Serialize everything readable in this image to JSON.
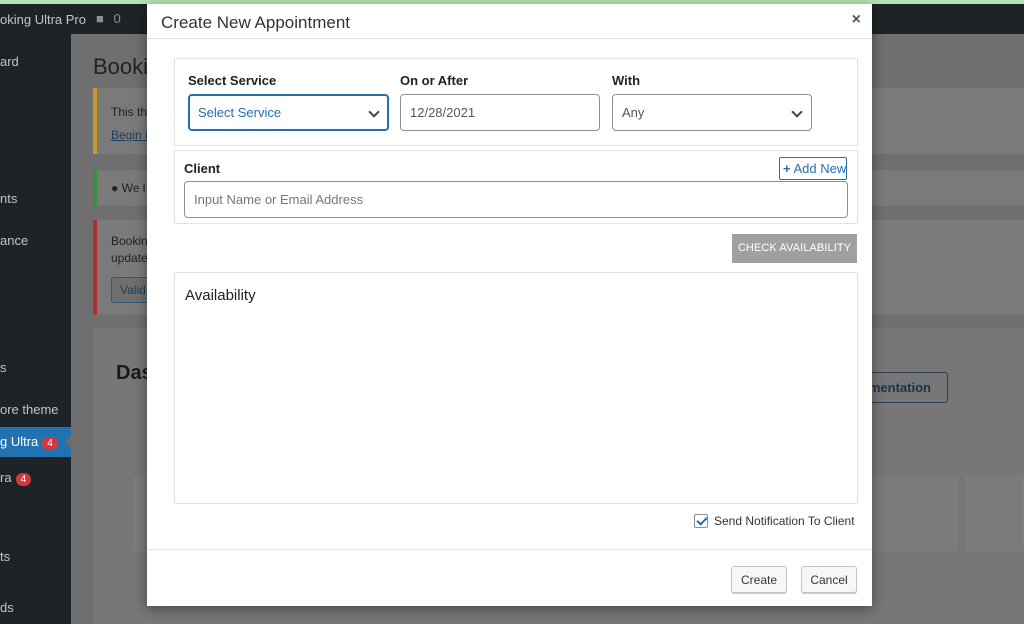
{
  "admin_bar": {
    "site_name": "oking Ultra Pro",
    "comments_count": "0"
  },
  "sidebar": {
    "items": [
      {
        "label": "ard"
      },
      {
        "label": "nts"
      },
      {
        "label": "ance"
      },
      {
        "label": "s"
      },
      {
        "label": "ore theme"
      },
      {
        "label": "g Ultra",
        "badge": "4"
      },
      {
        "label": "ra",
        "badge": "4"
      },
      {
        "label": "ts"
      },
      {
        "label": "ds"
      }
    ]
  },
  "background": {
    "page_title": "Booki",
    "notice1_text": "This th",
    "notice1_link": "Begin i",
    "notice2_text": "We l",
    "notice3_line1": "Bookin",
    "notice3_line2": "update",
    "notice3_button": "Valid",
    "dashboard_title": "Das",
    "documentation_button": "Documentation"
  },
  "modal": {
    "title": "Create New Appointment",
    "close_label": "×",
    "service": {
      "label": "Select Service",
      "value": "Select Service"
    },
    "date": {
      "label": "On or After",
      "value": "12/28/2021"
    },
    "with": {
      "label": "With",
      "value": "Any"
    },
    "client": {
      "label": "Client",
      "placeholder": "Input Name or Email Address",
      "add_new_label": "Add New"
    },
    "check_availability_label": "CHECK AVAILABILITY",
    "availability_title": "Availability",
    "send_notification": {
      "label": "Send Notification To Client",
      "checked": true
    },
    "buttons": {
      "create": "Create",
      "cancel": "Cancel"
    }
  },
  "colors": {
    "accent": "#2271b1",
    "check_button": "#a0a0a0",
    "admin_dark": "#1d2327"
  }
}
